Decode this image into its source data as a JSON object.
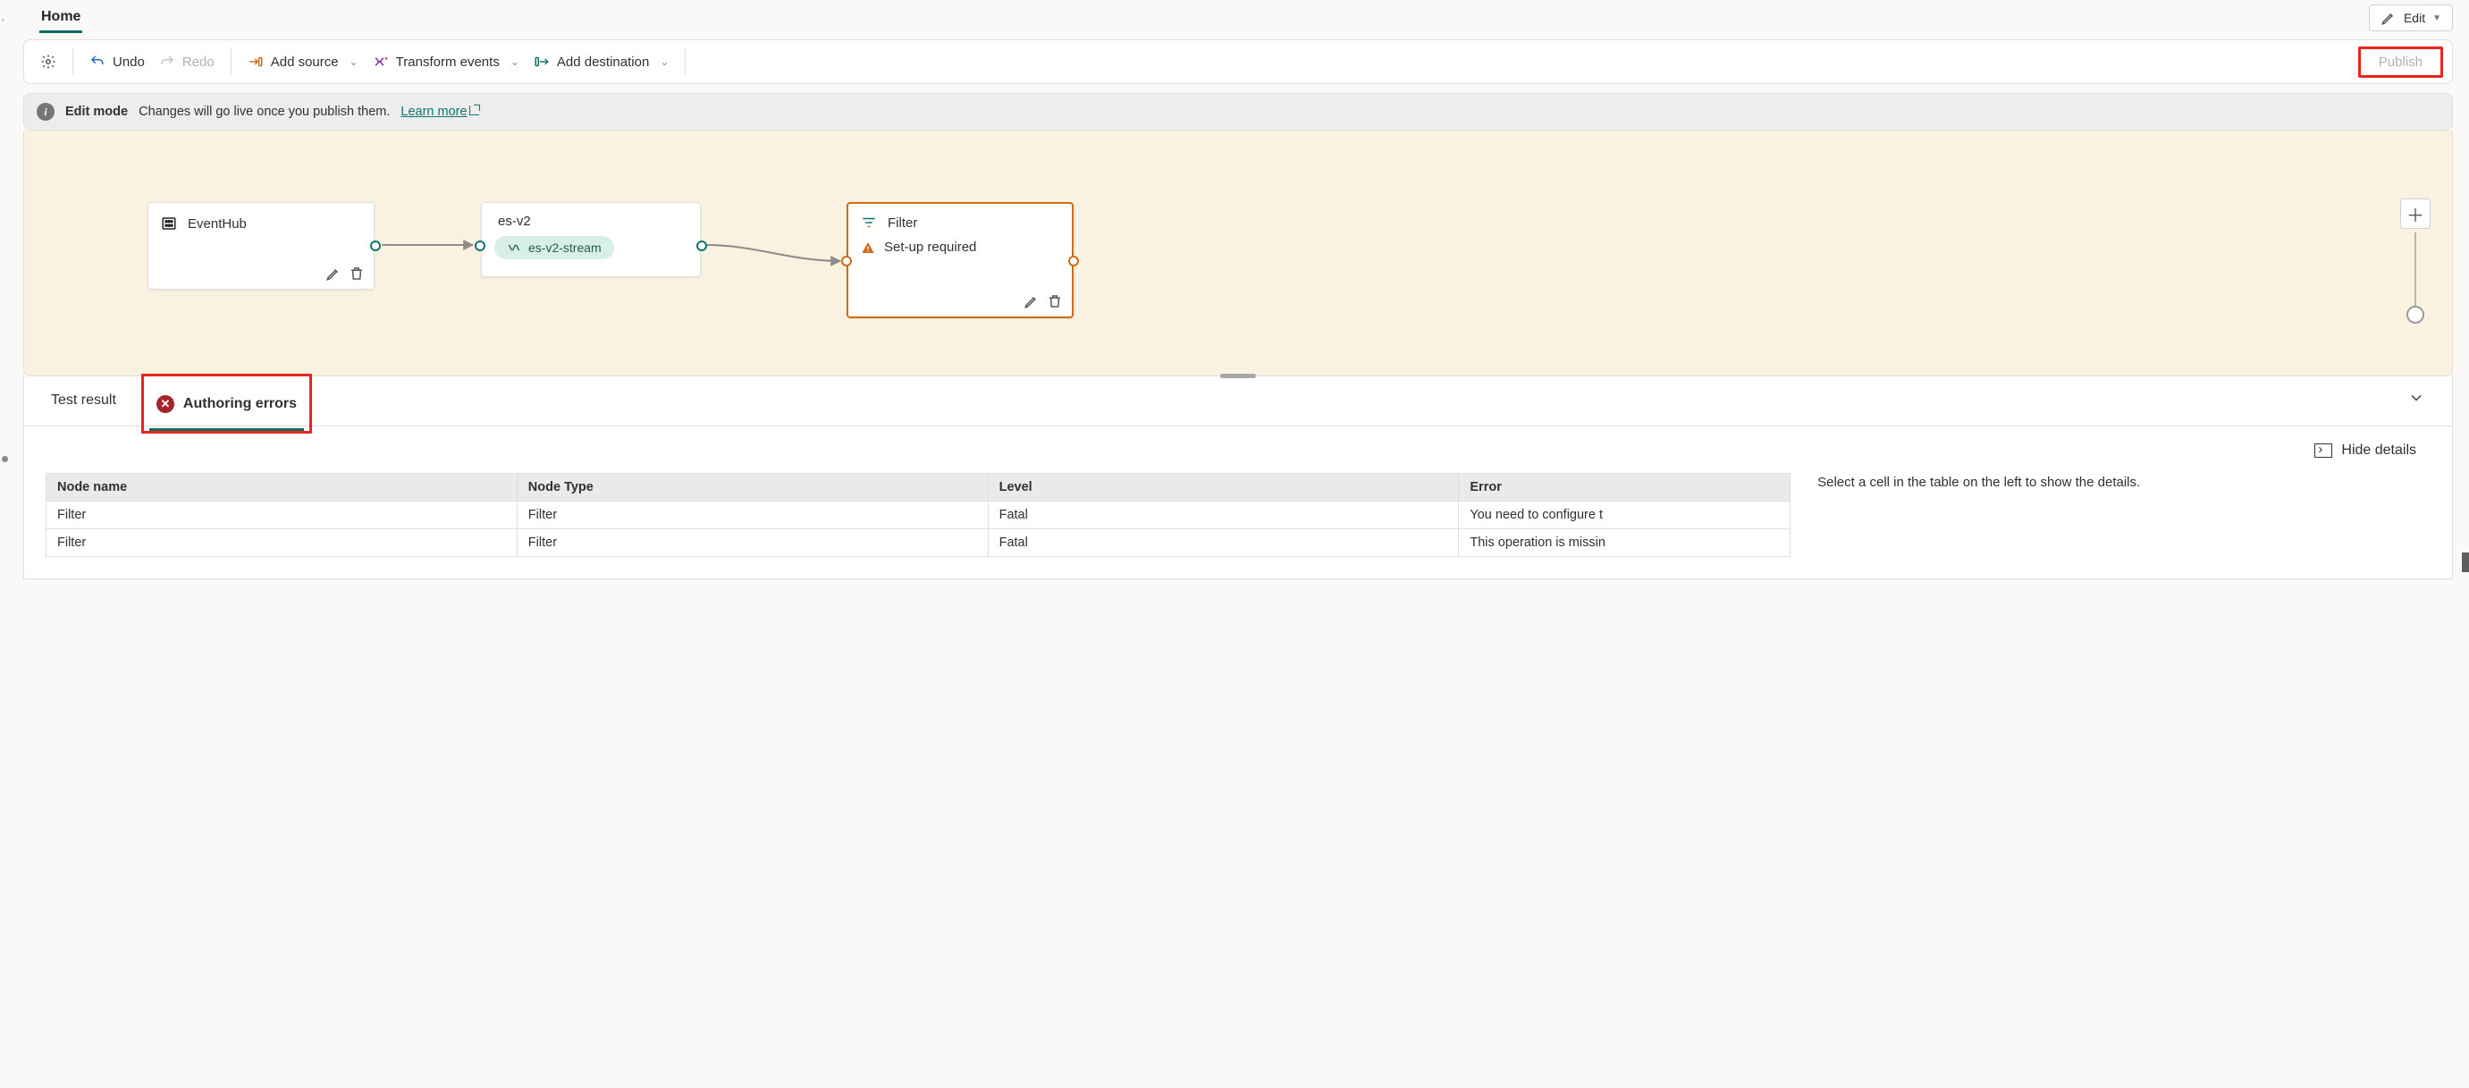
{
  "tabs": {
    "home": "Home"
  },
  "edit_menu": {
    "label": "Edit"
  },
  "toolbar": {
    "undo": "Undo",
    "redo": "Redo",
    "add_source": "Add source",
    "transform": "Transform events",
    "add_destination": "Add destination",
    "publish": "Publish"
  },
  "infobar": {
    "lead": "Edit mode",
    "body": "Changes will go live once you publish them.",
    "link": "Learn more"
  },
  "canvas": {
    "eventhub": {
      "title": "EventHub"
    },
    "esv2": {
      "title": "es-v2",
      "stream": "es-v2-stream"
    },
    "filter": {
      "title": "Filter",
      "status": "Set-up required"
    }
  },
  "bottom": {
    "tab_test": "Test result",
    "tab_errors": "Authoring errors",
    "hide_details": "Hide details",
    "detail_hint": "Select a cell in the table on the left to show the details.",
    "columns": {
      "node_name": "Node name",
      "node_type": "Node Type",
      "level": "Level",
      "error": "Error"
    },
    "rows": [
      {
        "node_name": "Filter",
        "node_type": "Filter",
        "level": "Fatal",
        "error": "You need to configure t"
      },
      {
        "node_name": "Filter",
        "node_type": "Filter",
        "level": "Fatal",
        "error": "This operation is missin"
      }
    ]
  }
}
